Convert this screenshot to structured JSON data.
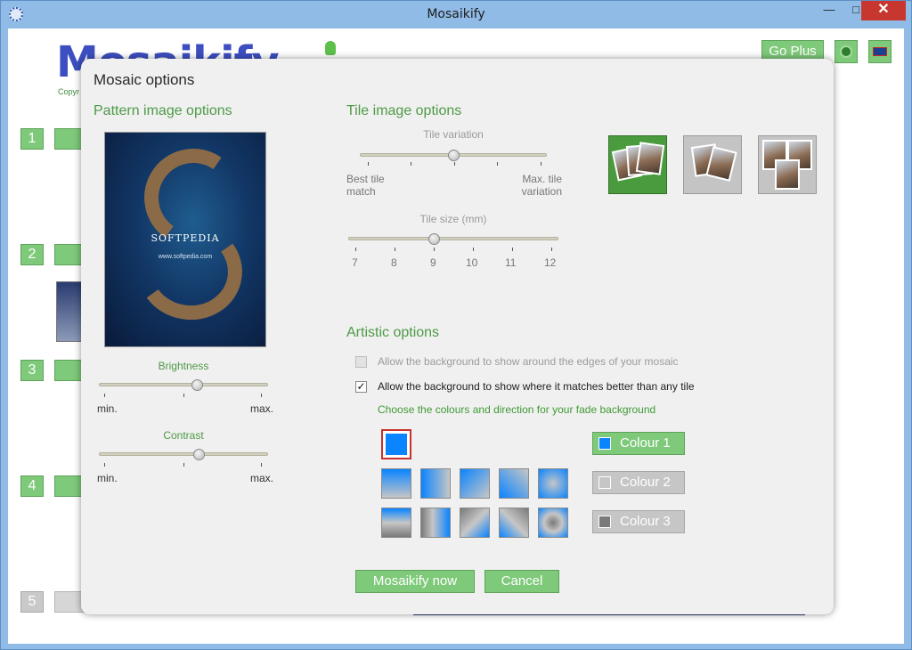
{
  "window": {
    "title": "Mosaikify"
  },
  "app": {
    "logo": "Mosaikify",
    "copyright": "Copyr",
    "go_plus": "Go Plus",
    "steps": [
      "1",
      "2",
      "3",
      "4",
      "5"
    ]
  },
  "modal": {
    "title": "Mosaic options",
    "pattern": {
      "heading": "Pattern image options",
      "watermark": "SOFTPEDIA",
      "watermark_url": "www.softpedia.com",
      "brightness": {
        "label": "Brightness",
        "min": "min.",
        "max": "max.",
        "value": 0.58
      },
      "contrast": {
        "label": "Contrast",
        "min": "min.",
        "max": "max.",
        "value": 0.59
      }
    },
    "tile": {
      "heading": "Tile image options",
      "variation": {
        "label": "Tile variation",
        "left": "Best tile match",
        "right": "Max. tile variation",
        "value": 0.5
      },
      "size": {
        "label": "Tile size (mm)",
        "ticks": [
          "7",
          "8",
          "9",
          "10",
          "11",
          "12"
        ],
        "value": 9
      },
      "selected_style": 0
    },
    "artistic": {
      "heading": "Artistic options",
      "opt1": {
        "label": "Allow the background to show around the edges of your mosaic",
        "checked": false,
        "enabled": false
      },
      "opt2": {
        "label": "Allow the background to show where it matches better than any tile",
        "checked": true,
        "enabled": true
      },
      "fade_label": "Choose the colours and direction for your fade background",
      "colour1": "Colour 1",
      "colour2": "Colour 2",
      "colour3": "Colour 3",
      "colours": {
        "c1": "#0a84ff",
        "c2": "#c6c6c6",
        "c3": "#7a7a7a"
      }
    },
    "buttons": {
      "ok": "Mosaikify now",
      "cancel": "Cancel"
    }
  }
}
